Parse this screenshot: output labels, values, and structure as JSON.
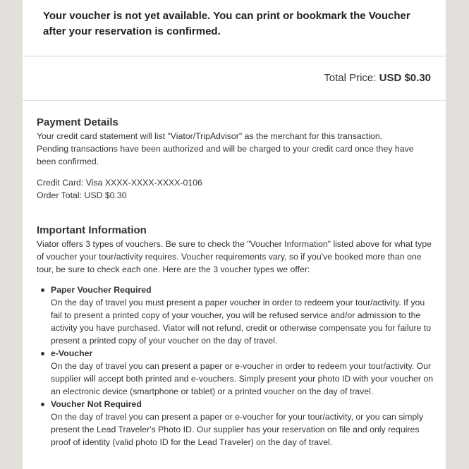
{
  "notice": "Your voucher is not yet available. You can print or bookmark the Voucher after your reservation is confirmed.",
  "total": {
    "label": "Total Price:",
    "amount": "USD $0.30"
  },
  "payment": {
    "title": "Payment Details",
    "statement": "Your credit card statement will list \"Viator/TripAdvisor\" as the merchant for this transaction.",
    "pending": "Pending transactions have been authorized and will be charged to your credit card once they have been confirmed.",
    "credit_card": "Credit Card: Visa XXXX-XXXX-XXXX-0106",
    "order_total": "Order Total: USD $0.30"
  },
  "important": {
    "title": "Important Information",
    "intro": "Viator offers 3 types of vouchers. Be sure to check the \"Voucher Information\" listed above for what type of voucher your tour/activity requires. Voucher requirements vary, so if you've booked more than one tour, be sure to check each one. Here are the 3 voucher types we offer:",
    "items": [
      {
        "title": "Paper Voucher Required",
        "body": "On the day of travel you must present a paper voucher in order to redeem your tour/activity. If you fail to present a printed copy of your voucher, you will be refused service and/or admission to the activity you have purchased. Viator will not refund, credit or otherwise compensate you for failure to present a printed copy of your voucher on the day of travel."
      },
      {
        "title": "e-Voucher",
        "body": "On the day of travel you can present a paper or e-voucher in order to redeem your tour/activity. Our supplier will accept both printed and e-vouchers. Simply present your photo ID with your voucher on an electronic device (smartphone or tablet) or a printed voucher on the day of travel."
      },
      {
        "title": "Voucher Not Required",
        "body": "On the day of travel you can present a paper or e-voucher for your tour/activity, or you can simply present the Lead Traveler's Photo ID. Our supplier has your reservation on file and only requires proof of identity (valid photo ID for the Lead Traveler) on the day of travel."
      }
    ]
  }
}
